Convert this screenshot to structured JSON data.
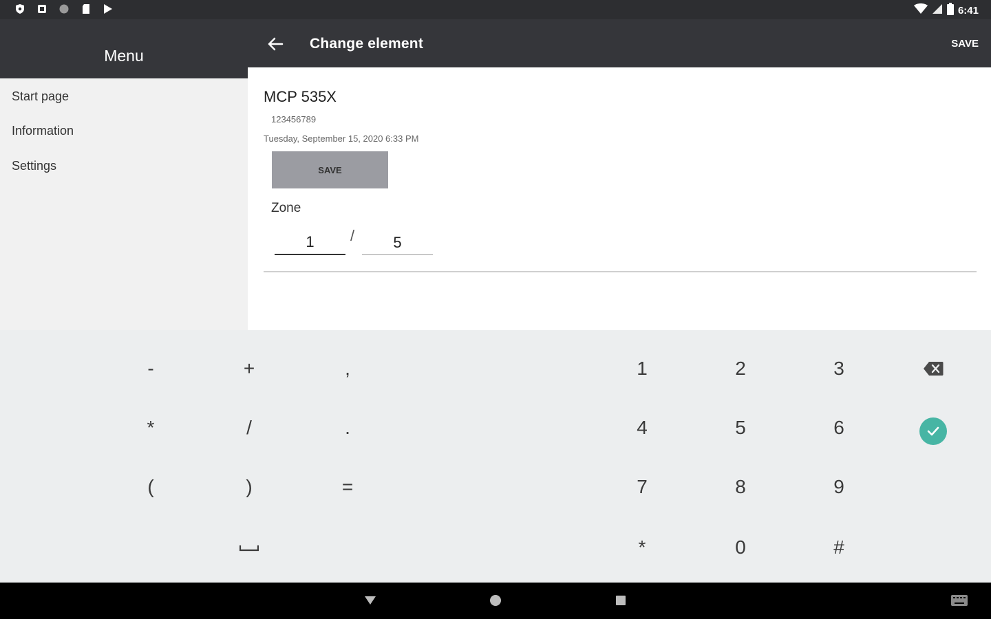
{
  "status_bar": {
    "time": "6:41"
  },
  "drawer": {
    "title": "Menu",
    "items": [
      {
        "label": "Start page"
      },
      {
        "label": "Information"
      },
      {
        "label": "Settings"
      }
    ]
  },
  "app_bar": {
    "title": "Change element",
    "save_label": "SAVE"
  },
  "content": {
    "device_name": "MCP 535X",
    "serial": "123456789",
    "timestamp": "Tuesday, September 15, 2020 6:33 PM",
    "save_button": "SAVE",
    "zone_label": "Zone",
    "zone_current": "1",
    "zone_separator": "/",
    "zone_max": "5"
  },
  "keyboard": {
    "rows": [
      [
        "-",
        "+",
        ",",
        "1",
        "2",
        "3"
      ],
      [
        "*",
        "/",
        ".",
        "4",
        "5",
        "6"
      ],
      [
        "(",
        ")",
        "=",
        "7",
        "8",
        "9"
      ],
      [
        "*",
        "0",
        "#"
      ]
    ]
  },
  "colors": {
    "bar": "#35363a",
    "accent": "#47b5a4",
    "keyboard_bg": "#eceeef",
    "drawer_bg": "#f1f1f1"
  }
}
